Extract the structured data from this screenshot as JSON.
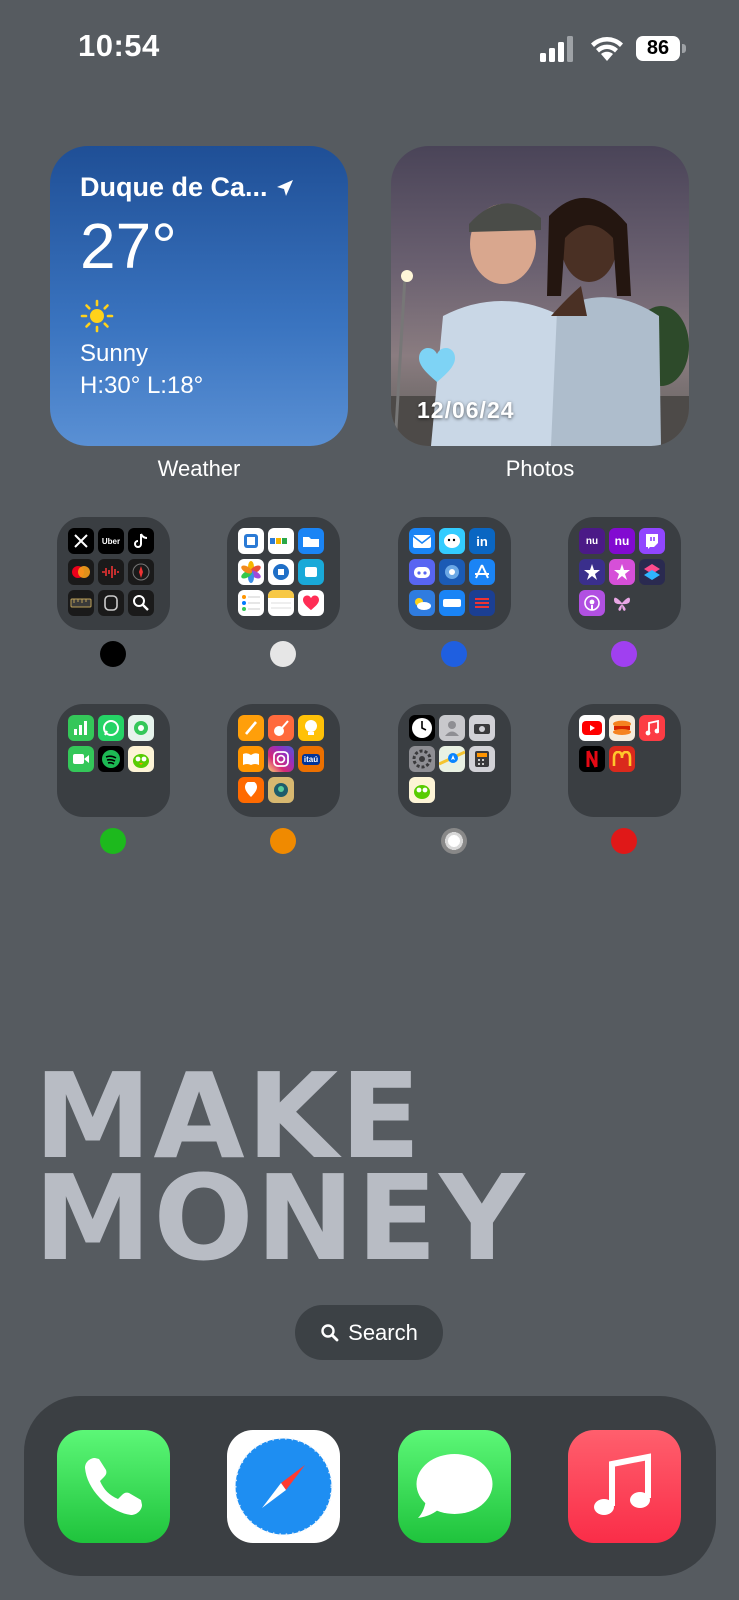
{
  "status_bar": {
    "time": "10:54",
    "battery": "86"
  },
  "weather_widget": {
    "city": "Duque de Ca...",
    "temperature": "27°",
    "condition": "Sunny",
    "high_low": "H:30° L:18°",
    "label": "Weather"
  },
  "photos_widget": {
    "date": "12/06/24",
    "label": "Photos"
  },
  "folders": [
    {
      "dot_color": "#000000"
    },
    {
      "dot_color": "#e6e6e6"
    },
    {
      "dot_color": "#1f5fe0"
    },
    {
      "dot_color": "#a040f0"
    },
    {
      "dot_color": "#1db91d"
    },
    {
      "dot_color": "#f08a00"
    },
    {
      "dot_color": "#d8d8d8"
    },
    {
      "dot_color": "#e01818"
    }
  ],
  "folder_labels": {
    "uber": "Uber",
    "nu": "nu",
    "itau": "itaú"
  },
  "banner": {
    "line1": "MAKE",
    "line2": "MONEY"
  },
  "search": {
    "label": "Search"
  },
  "dock": {
    "apps": [
      "phone",
      "safari",
      "messages",
      "music"
    ]
  }
}
